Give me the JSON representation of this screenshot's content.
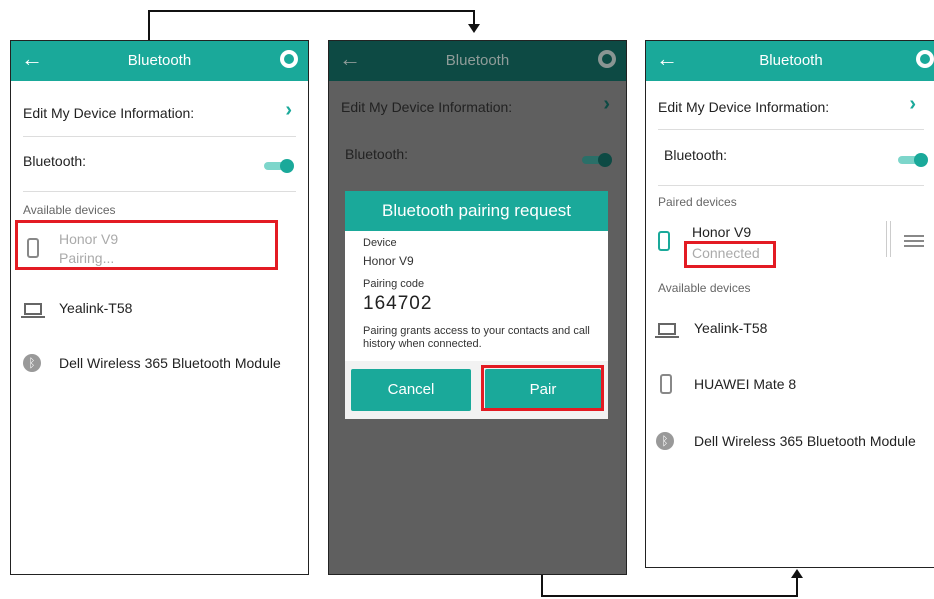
{
  "screen1": {
    "header_title": "Bluetooth",
    "edit_label": "Edit My Device Information:",
    "bluetooth_label": "Bluetooth:",
    "available_label": "Available devices",
    "devices": [
      {
        "name": "Honor V9",
        "status": "Pairing..."
      },
      {
        "name": "Yealink-T58"
      },
      {
        "name": "Dell Wireless 365 Bluetooth Module"
      }
    ]
  },
  "screen2": {
    "header_title": "Bluetooth",
    "edit_label": "Edit My Device Information:",
    "bluetooth_label": "Bluetooth:",
    "dialog": {
      "title": "Bluetooth pairing request",
      "device_label": "Device",
      "device_value": "Honor V9",
      "code_label": "Pairing code",
      "code_value": "164702",
      "note": "Pairing grants access to your contacts and call history when connected.",
      "cancel": "Cancel",
      "pair": "Pair"
    }
  },
  "screen3": {
    "header_title": "Bluetooth",
    "edit_label": "Edit My Device Information:",
    "bluetooth_label": "Bluetooth:",
    "paired_label": "Paired devices",
    "paired": {
      "name": "Honor V9",
      "status": "Connected"
    },
    "available_label": "Available devices",
    "devices": [
      {
        "name": "Yealink-T58"
      },
      {
        "name": "HUAWEI Mate 8"
      },
      {
        "name": "Dell Wireless 365 Bluetooth Module"
      }
    ]
  },
  "icons": {
    "back": "back-arrow-icon",
    "globe": "globe-icon",
    "chevron": "chevron-right-icon",
    "phone": "phone-icon",
    "laptop": "laptop-icon",
    "bluetooth": "bluetooth-icon",
    "settings": "sliders-icon"
  },
  "colors": {
    "accent": "#1aa99a",
    "highlight": "#e31b23"
  }
}
